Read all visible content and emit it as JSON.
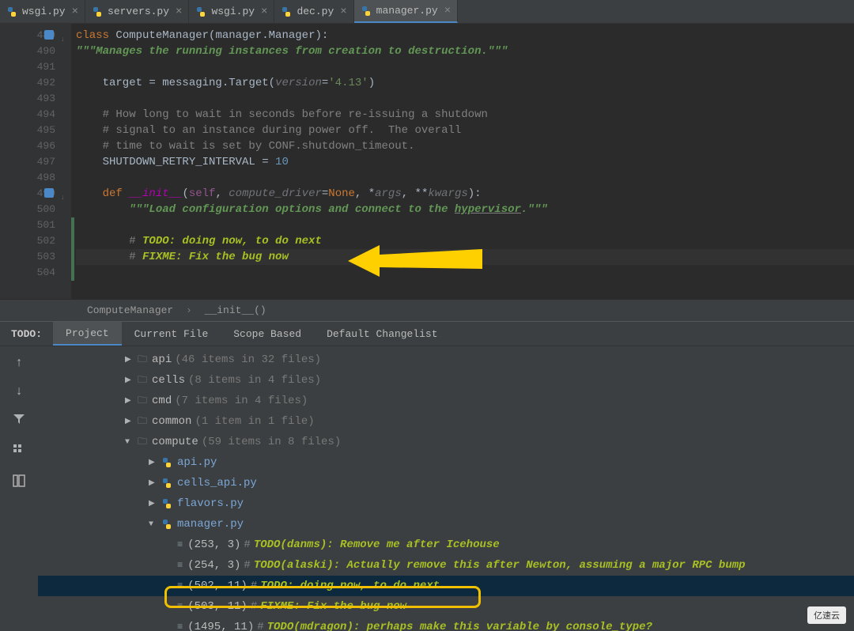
{
  "tabs": [
    {
      "name": "wsgi.py",
      "active": false
    },
    {
      "name": "servers.py",
      "active": false
    },
    {
      "name": "wsgi.py",
      "active": false
    },
    {
      "name": "dec.py",
      "active": false
    },
    {
      "name": "manager.py",
      "active": true
    }
  ],
  "editor": {
    "lines": [
      {
        "no": "489",
        "marker": "blue",
        "arrow": true
      },
      {
        "no": "490"
      },
      {
        "no": "491"
      },
      {
        "no": "492"
      },
      {
        "no": "493"
      },
      {
        "no": "494"
      },
      {
        "no": "495"
      },
      {
        "no": "496"
      },
      {
        "no": "497"
      },
      {
        "no": "498"
      },
      {
        "no": "499",
        "marker": "blue",
        "arrow": true
      },
      {
        "no": "500"
      },
      {
        "no": "501"
      },
      {
        "no": "502"
      },
      {
        "no": "503"
      },
      {
        "no": "504"
      }
    ],
    "code": {
      "l489_kw": "class ",
      "l489_cls": "ComputeManager",
      "l489_paren": "(manager.Manager):",
      "l490": "\"\"\"Manages the running instances from creation to destruction.\"\"\"",
      "l492_target": "    target = messaging.",
      "l492_Target": "Target",
      "l492_paren": "(",
      "l492_version": "version",
      "l492_eq": "=",
      "l492_val": "'4.13'",
      "l492_close": ")",
      "l494": "    # How long to wait in seconds before re-issuing a shutdown",
      "l495": "    # signal to an instance during power off.  The overall",
      "l496": "    # time to wait is set by CONF.shutdown_timeout.",
      "l497_a": "    SHUTDOWN_RETRY_INTERVAL = ",
      "l497_b": "10",
      "l499_def": "    def ",
      "l499_name": "__init__",
      "l499_open": "(",
      "l499_self": "self",
      "l499_c1": ", ",
      "l499_p1": "compute_driver",
      "l499_eq": "=",
      "l499_none": "None",
      "l499_c2": ", *",
      "l499_args": "args",
      "l499_c3": ", **",
      "l499_kw2": "kwargs",
      "l499_close": "):",
      "l500_a": "        \"\"\"Load configuration options and connect to the ",
      "l500_b": "hypervisor",
      "l500_c": ".\"\"\"",
      "l502_a": "        # ",
      "l502_b": "TODO: doing now, to do next",
      "l503_a": "        # ",
      "l503_b": "FIXME: Fix the bug now"
    }
  },
  "breadcrumb": {
    "a": "ComputeManager",
    "b": "__init__()"
  },
  "todo_header": {
    "label": "TODO:",
    "scopes": [
      "Project",
      "Current File",
      "Scope Based",
      "Default Changelist"
    ]
  },
  "tree": {
    "api": {
      "name": "api",
      "count": "(46 items in 32 files)"
    },
    "cells": {
      "name": "cells",
      "count": "(8 items in 4 files)"
    },
    "cmd": {
      "name": "cmd",
      "count": "(7 items in 4 files)"
    },
    "common": {
      "name": "common",
      "count": "(1 item in 1 file)"
    },
    "compute": {
      "name": "compute",
      "count": "(59 items in 8 files)"
    },
    "files": {
      "api": "api.py",
      "cells_api": "cells_api.py",
      "flavors": "flavors.py",
      "manager": "manager.py"
    },
    "items": [
      {
        "pos": "(253, 3)",
        "text": "TODO(danms): Remove me after Icehouse"
      },
      {
        "pos": "(254, 3)",
        "text": "TODO(alaski): Actually remove this after Newton, assuming a major RPC bump"
      },
      {
        "pos": "(502, 11)",
        "text": "TODO: doing now, to do next"
      },
      {
        "pos": "(503, 11)",
        "text": "FIXME: Fix the bug now"
      },
      {
        "pos": "(1495, 11)",
        "text": "TODO(mdragon): perhaps make this variable by console_type?"
      }
    ]
  },
  "watermark": "亿速云"
}
